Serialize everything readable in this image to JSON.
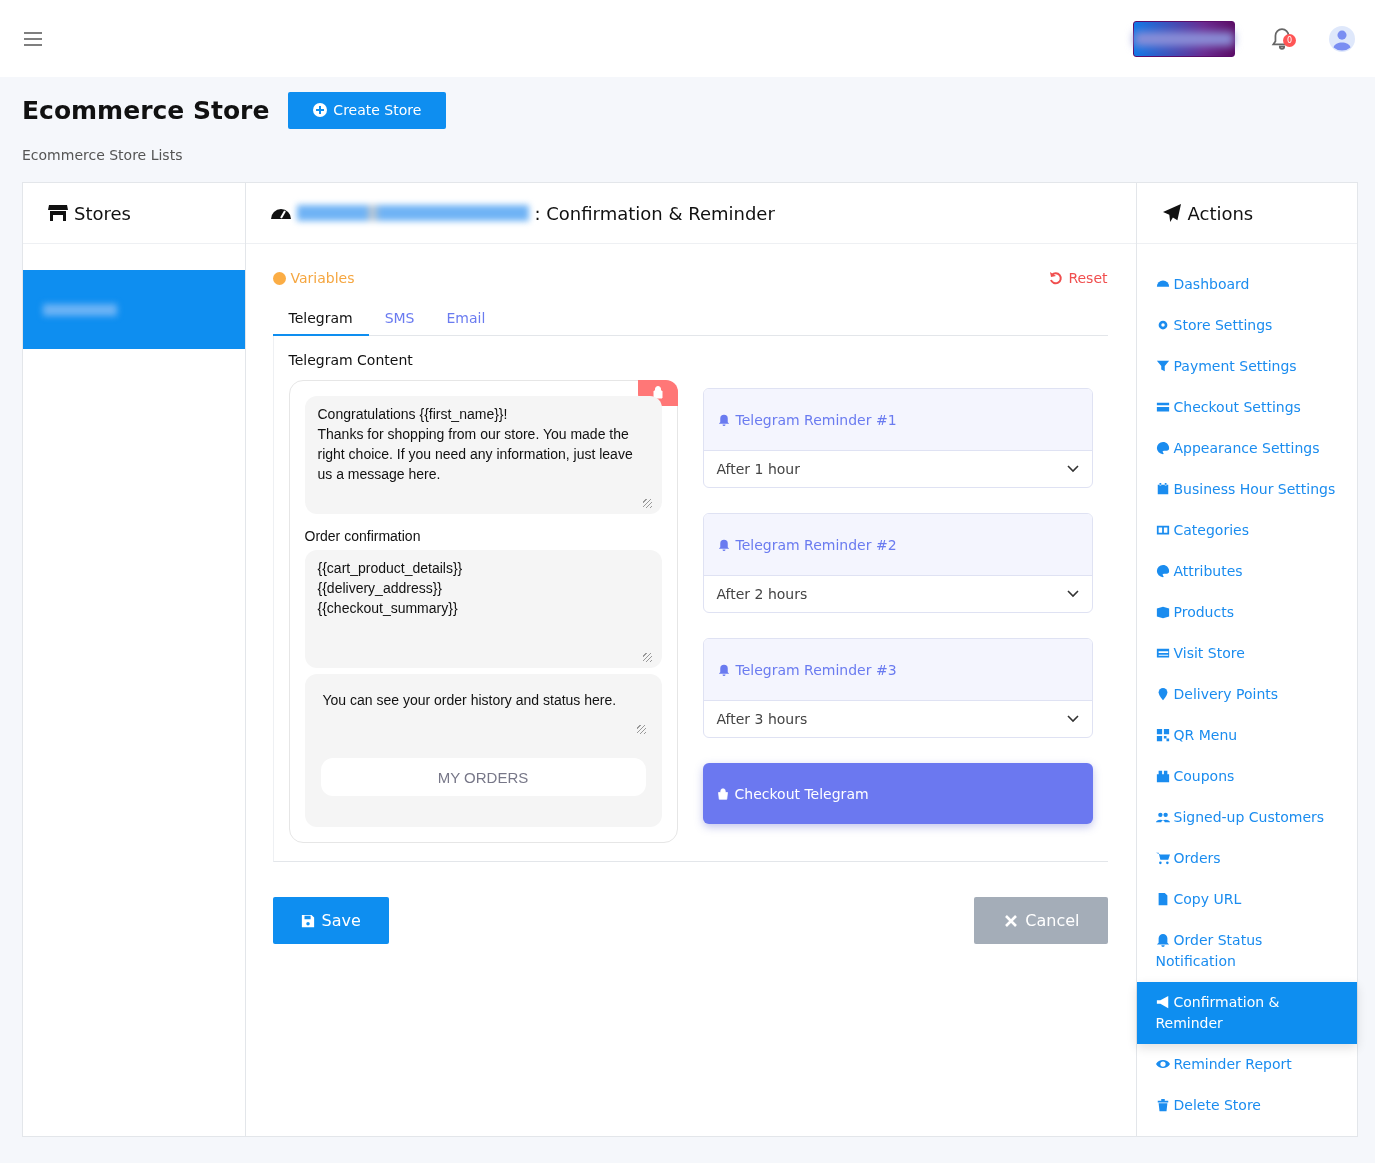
{
  "topbar": {
    "notification_count": "0"
  },
  "page": {
    "title": "Ecommerce Store",
    "create_button": "Create Store",
    "subtitle": "Ecommerce Store Lists"
  },
  "stores": {
    "title": "Stores",
    "items": [
      {
        "selected": true
      }
    ]
  },
  "editor": {
    "title_suffix": ": Confirmation & Reminder",
    "variables": "Variables",
    "reset": "Reset",
    "tabs": [
      {
        "label": "Telegram",
        "selected": true
      },
      {
        "label": "SMS",
        "selected": false
      },
      {
        "label": "Email",
        "selected": false
      }
    ],
    "content_label": "Telegram Content",
    "preview": {
      "greeting": "Congratulations {{first_name}}!\nThanks for shopping from our store. You made the right choice. If you need any information, just leave us a message here.",
      "confirmation_label": "Order confirmation",
      "confirmation": "{{cart_product_details}}\n{{delivery_address}}\n{{checkout_summary}}",
      "history": "You can see your order history and status here.",
      "orders_button": "MY ORDERS"
    },
    "reminders": [
      {
        "title": "Telegram Reminder #1",
        "value": "After 1 hour"
      },
      {
        "title": "Telegram Reminder #2",
        "value": "After 2 hours"
      },
      {
        "title": "Telegram Reminder #3",
        "value": "After 3 hours"
      }
    ],
    "checkout_button": "Checkout Telegram",
    "save": "Save",
    "cancel": "Cancel"
  },
  "actions": {
    "title": "Actions",
    "items": [
      {
        "label": "Dashboard",
        "selected": false
      },
      {
        "label": "Store Settings",
        "selected": false
      },
      {
        "label": "Payment Settings",
        "selected": false
      },
      {
        "label": "Checkout Settings",
        "selected": false
      },
      {
        "label": "Appearance Settings",
        "selected": false
      },
      {
        "label": "Business Hour Settings",
        "selected": false
      },
      {
        "label": "Categories",
        "selected": false
      },
      {
        "label": "Attributes",
        "selected": false
      },
      {
        "label": "Products",
        "selected": false
      },
      {
        "label": "Visit Store",
        "selected": false
      },
      {
        "label": "Delivery Points",
        "selected": false
      },
      {
        "label": "QR Menu",
        "selected": false
      },
      {
        "label": "Coupons",
        "selected": false
      },
      {
        "label": "Signed-up Customers",
        "selected": false
      },
      {
        "label": "Orders",
        "selected": false
      },
      {
        "label": "Copy URL",
        "selected": false
      },
      {
        "label": "Order Status Notification",
        "selected": false
      },
      {
        "label": "Confirmation & Reminder",
        "selected": true
      },
      {
        "label": "Reminder Report",
        "selected": false
      },
      {
        "label": "Delete Store",
        "selected": false
      }
    ]
  }
}
